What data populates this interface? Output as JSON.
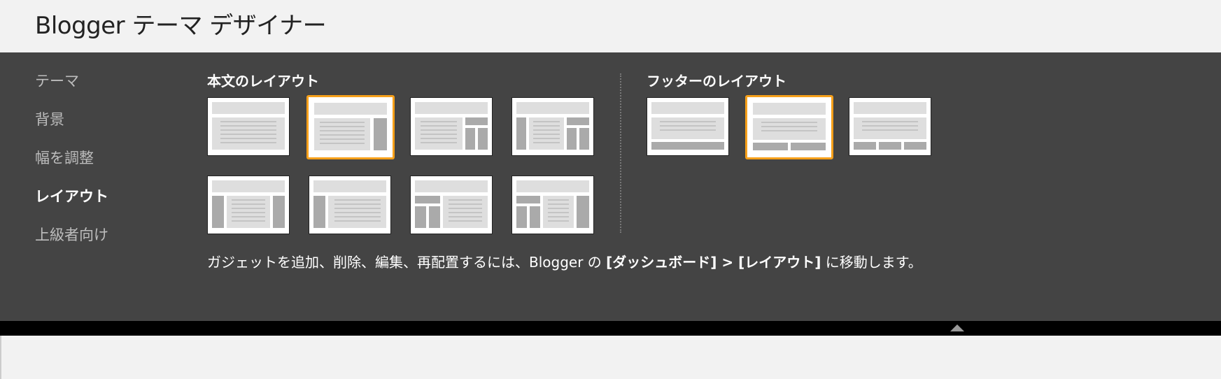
{
  "header": {
    "title": "Blogger テーマ デザイナー"
  },
  "sidebar": {
    "items": [
      {
        "label": "テーマ"
      },
      {
        "label": "背景"
      },
      {
        "label": "幅を調整"
      },
      {
        "label": "レイアウト",
        "active": true
      },
      {
        "label": "上級者向け"
      }
    ]
  },
  "body_layout": {
    "title": "本文のレイアウト",
    "options": [
      {
        "name": "single-column",
        "selected": false
      },
      {
        "name": "right-sidebar",
        "selected": true
      },
      {
        "name": "right-sidebar-split",
        "selected": false
      },
      {
        "name": "left-right-sidebar-split",
        "selected": false
      },
      {
        "name": "both-sidebars",
        "selected": false
      },
      {
        "name": "left-sidebar",
        "selected": false
      },
      {
        "name": "left-sidebar-split",
        "selected": false
      },
      {
        "name": "left-split-right-sidebar",
        "selected": false
      }
    ]
  },
  "footer_layout": {
    "title": "フッターのレイアウト",
    "options": [
      {
        "name": "footer-one-column",
        "selected": false
      },
      {
        "name": "footer-two-columns",
        "selected": true
      },
      {
        "name": "footer-three-columns",
        "selected": false
      }
    ]
  },
  "info": {
    "prefix": "ガジェットを追加、削除、編集、再配置するには、Blogger の ",
    "bold": "[ダッシュボード] > [レイアウト]",
    "suffix": " に移動します。"
  },
  "colors": {
    "accent": "#f6a01a",
    "panel": "#444444",
    "inactive_text": "#bdbdbd"
  },
  "icons": {
    "collapse": "triangle-up-icon"
  }
}
